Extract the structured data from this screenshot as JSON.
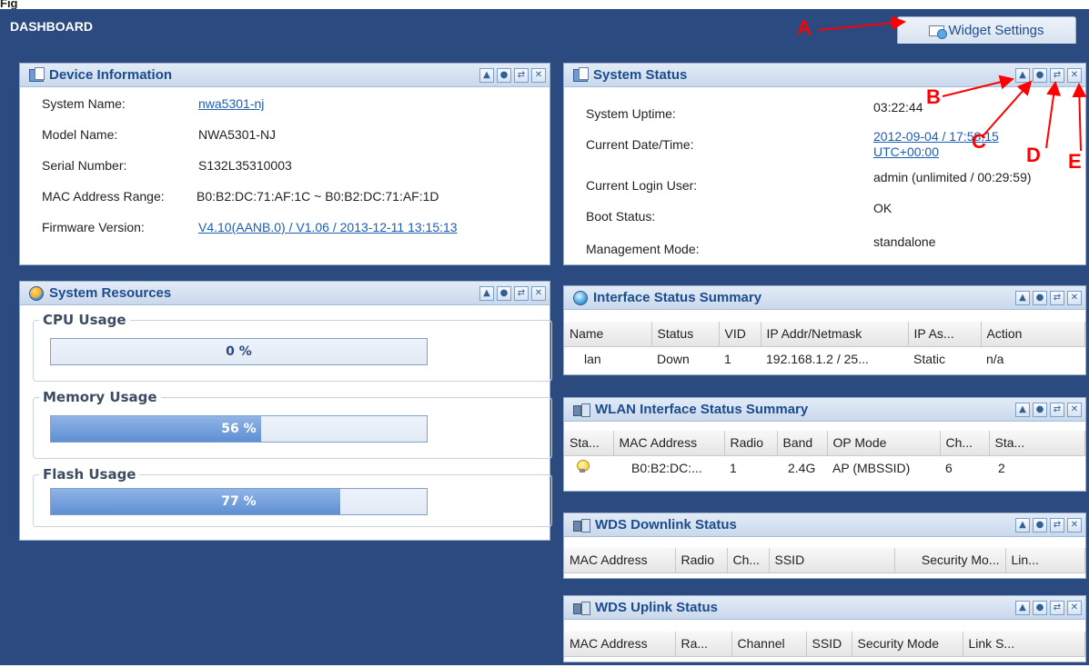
{
  "figure_label": "Fig",
  "header": {
    "title": "DASHBOARD",
    "widget_settings_label": "Widget Settings"
  },
  "controls": {
    "up": "▲",
    "settings": "●",
    "refresh": "⇄",
    "close": "✕"
  },
  "device_info": {
    "title": "Device Information",
    "rows": [
      {
        "label": "System Name:",
        "value": "nwa5301-nj",
        "link": true
      },
      {
        "label": "Model Name:",
        "value": "NWA5301-NJ",
        "link": false
      },
      {
        "label": "Serial Number:",
        "value": "S132L35310003",
        "link": false
      },
      {
        "label": "MAC Address Range:",
        "value": "B0:B2:DC:71:AF:1C ~ B0:B2:DC:71:AF:1D",
        "link": false
      },
      {
        "label": "Firmware Version:",
        "value": "V4.10(AANB.0) / V1.06 / 2013-12-11 13:15:13",
        "link": true
      }
    ]
  },
  "system_status": {
    "title": "System Status",
    "uptime_label": "System Uptime:",
    "uptime_value": "03:22:44",
    "datetime_label": "Current Date/Time:",
    "datetime_value_line1": "2012-09-04 / 17:58:15",
    "datetime_value_line2": "UTC+00:00",
    "login_label": "Current Login User:",
    "login_value": "admin (unlimited / 00:29:59)",
    "boot_label": "Boot Status:",
    "boot_value": "OK",
    "mode_label": "Management Mode:",
    "mode_value": "standalone"
  },
  "system_resources": {
    "title": "System Resources",
    "cpu": {
      "label": "CPU Usage",
      "percent": 0,
      "text": "0 %"
    },
    "memory": {
      "label": "Memory Usage",
      "percent": 56,
      "text": "56 %"
    },
    "flash": {
      "label": "Flash Usage",
      "percent": 77,
      "text": "77 %"
    }
  },
  "interface_status": {
    "title": "Interface Status Summary",
    "columns": [
      "Name",
      "Status",
      "VID",
      "IP Addr/Netmask",
      "IP As...",
      "Action"
    ],
    "rows": [
      [
        "lan",
        "Down",
        "1",
        "192.168.1.2 / 25...",
        "Static",
        "n/a"
      ]
    ]
  },
  "wlan_status": {
    "title": "WLAN Interface Status Summary",
    "columns": [
      "Sta...",
      "MAC Address",
      "Radio",
      "Band",
      "OP Mode",
      "Ch...",
      "Sta..."
    ],
    "rows": [
      [
        "",
        "B0:B2:DC:...",
        "1",
        "2.4G",
        "AP (MBSSID)",
        "6",
        "2"
      ]
    ]
  },
  "wds_downlink": {
    "title": "WDS Downlink Status",
    "columns": [
      "MAC Address",
      "Radio",
      "Ch...",
      "SSID",
      "Security Mo...",
      "Lin..."
    ]
  },
  "wds_uplink": {
    "title": "WDS Uplink Status",
    "columns": [
      "MAC Address",
      "Ra...",
      "Channel",
      "SSID",
      "Security Mode",
      "Link S..."
    ]
  },
  "callouts": {
    "a": "A",
    "b": "B",
    "c": "C",
    "d": "D",
    "e": "E"
  }
}
